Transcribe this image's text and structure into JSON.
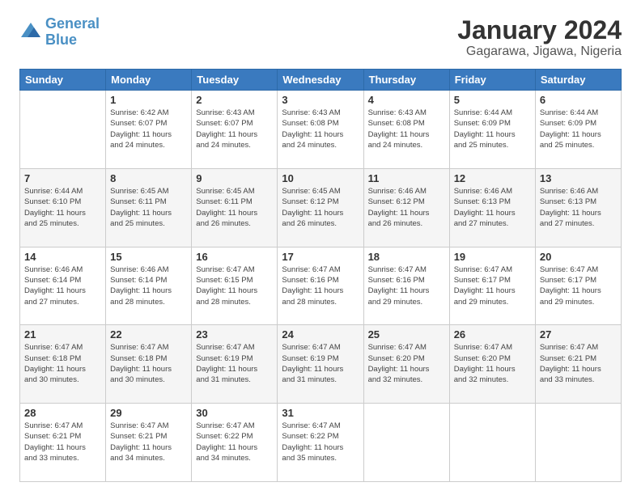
{
  "logo": {
    "line1": "General",
    "line2": "Blue"
  },
  "title": "January 2024",
  "subtitle": "Gagarawa, Jigawa, Nigeria",
  "days_of_week": [
    "Sunday",
    "Monday",
    "Tuesday",
    "Wednesday",
    "Thursday",
    "Friday",
    "Saturday"
  ],
  "weeks": [
    [
      {
        "day": "",
        "info": ""
      },
      {
        "day": "1",
        "info": "Sunrise: 6:42 AM\nSunset: 6:07 PM\nDaylight: 11 hours\nand 24 minutes."
      },
      {
        "day": "2",
        "info": "Sunrise: 6:43 AM\nSunset: 6:07 PM\nDaylight: 11 hours\nand 24 minutes."
      },
      {
        "day": "3",
        "info": "Sunrise: 6:43 AM\nSunset: 6:08 PM\nDaylight: 11 hours\nand 24 minutes."
      },
      {
        "day": "4",
        "info": "Sunrise: 6:43 AM\nSunset: 6:08 PM\nDaylight: 11 hours\nand 24 minutes."
      },
      {
        "day": "5",
        "info": "Sunrise: 6:44 AM\nSunset: 6:09 PM\nDaylight: 11 hours\nand 25 minutes."
      },
      {
        "day": "6",
        "info": "Sunrise: 6:44 AM\nSunset: 6:09 PM\nDaylight: 11 hours\nand 25 minutes."
      }
    ],
    [
      {
        "day": "7",
        "info": "Sunrise: 6:44 AM\nSunset: 6:10 PM\nDaylight: 11 hours\nand 25 minutes."
      },
      {
        "day": "8",
        "info": "Sunrise: 6:45 AM\nSunset: 6:11 PM\nDaylight: 11 hours\nand 25 minutes."
      },
      {
        "day": "9",
        "info": "Sunrise: 6:45 AM\nSunset: 6:11 PM\nDaylight: 11 hours\nand 26 minutes."
      },
      {
        "day": "10",
        "info": "Sunrise: 6:45 AM\nSunset: 6:12 PM\nDaylight: 11 hours\nand 26 minutes."
      },
      {
        "day": "11",
        "info": "Sunrise: 6:46 AM\nSunset: 6:12 PM\nDaylight: 11 hours\nand 26 minutes."
      },
      {
        "day": "12",
        "info": "Sunrise: 6:46 AM\nSunset: 6:13 PM\nDaylight: 11 hours\nand 27 minutes."
      },
      {
        "day": "13",
        "info": "Sunrise: 6:46 AM\nSunset: 6:13 PM\nDaylight: 11 hours\nand 27 minutes."
      }
    ],
    [
      {
        "day": "14",
        "info": "Sunrise: 6:46 AM\nSunset: 6:14 PM\nDaylight: 11 hours\nand 27 minutes."
      },
      {
        "day": "15",
        "info": "Sunrise: 6:46 AM\nSunset: 6:14 PM\nDaylight: 11 hours\nand 28 minutes."
      },
      {
        "day": "16",
        "info": "Sunrise: 6:47 AM\nSunset: 6:15 PM\nDaylight: 11 hours\nand 28 minutes."
      },
      {
        "day": "17",
        "info": "Sunrise: 6:47 AM\nSunset: 6:16 PM\nDaylight: 11 hours\nand 28 minutes."
      },
      {
        "day": "18",
        "info": "Sunrise: 6:47 AM\nSunset: 6:16 PM\nDaylight: 11 hours\nand 29 minutes."
      },
      {
        "day": "19",
        "info": "Sunrise: 6:47 AM\nSunset: 6:17 PM\nDaylight: 11 hours\nand 29 minutes."
      },
      {
        "day": "20",
        "info": "Sunrise: 6:47 AM\nSunset: 6:17 PM\nDaylight: 11 hours\nand 29 minutes."
      }
    ],
    [
      {
        "day": "21",
        "info": "Sunrise: 6:47 AM\nSunset: 6:18 PM\nDaylight: 11 hours\nand 30 minutes."
      },
      {
        "day": "22",
        "info": "Sunrise: 6:47 AM\nSunset: 6:18 PM\nDaylight: 11 hours\nand 30 minutes."
      },
      {
        "day": "23",
        "info": "Sunrise: 6:47 AM\nSunset: 6:19 PM\nDaylight: 11 hours\nand 31 minutes."
      },
      {
        "day": "24",
        "info": "Sunrise: 6:47 AM\nSunset: 6:19 PM\nDaylight: 11 hours\nand 31 minutes."
      },
      {
        "day": "25",
        "info": "Sunrise: 6:47 AM\nSunset: 6:20 PM\nDaylight: 11 hours\nand 32 minutes."
      },
      {
        "day": "26",
        "info": "Sunrise: 6:47 AM\nSunset: 6:20 PM\nDaylight: 11 hours\nand 32 minutes."
      },
      {
        "day": "27",
        "info": "Sunrise: 6:47 AM\nSunset: 6:21 PM\nDaylight: 11 hours\nand 33 minutes."
      }
    ],
    [
      {
        "day": "28",
        "info": "Sunrise: 6:47 AM\nSunset: 6:21 PM\nDaylight: 11 hours\nand 33 minutes."
      },
      {
        "day": "29",
        "info": "Sunrise: 6:47 AM\nSunset: 6:21 PM\nDaylight: 11 hours\nand 34 minutes."
      },
      {
        "day": "30",
        "info": "Sunrise: 6:47 AM\nSunset: 6:22 PM\nDaylight: 11 hours\nand 34 minutes."
      },
      {
        "day": "31",
        "info": "Sunrise: 6:47 AM\nSunset: 6:22 PM\nDaylight: 11 hours\nand 35 minutes."
      },
      {
        "day": "",
        "info": ""
      },
      {
        "day": "",
        "info": ""
      },
      {
        "day": "",
        "info": ""
      }
    ]
  ]
}
